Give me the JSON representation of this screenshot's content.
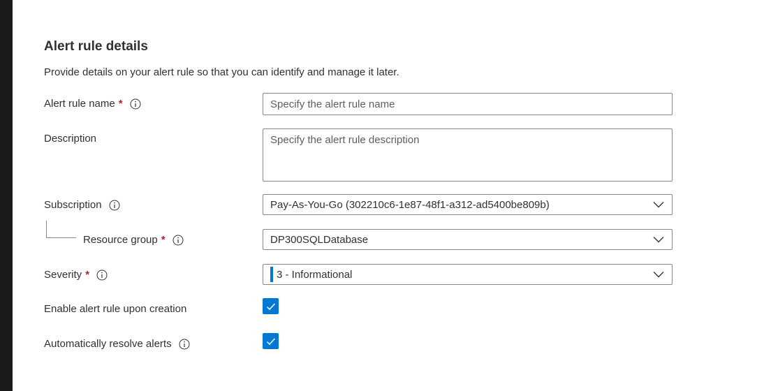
{
  "section": {
    "title": "Alert rule details",
    "description": "Provide details on your alert rule so that you can identify and manage it later."
  },
  "fields": {
    "alert_rule_name": {
      "label": "Alert rule name",
      "required_marker": "*",
      "value": "",
      "placeholder": "Specify the alert rule name"
    },
    "description": {
      "label": "Description",
      "value": "",
      "placeholder": "Specify the alert rule description"
    },
    "subscription": {
      "label": "Subscription",
      "value": "Pay-As-You-Go (302210c6-1e87-48f1-a312-ad5400be809b)"
    },
    "resource_group": {
      "label": "Resource group",
      "required_marker": "*",
      "value": "DP300SQLDatabase"
    },
    "severity": {
      "label": "Severity",
      "required_marker": "*",
      "value": "3 - Informational",
      "color": "#0078d4"
    },
    "enable_on_creation": {
      "label": "Enable alert rule upon creation",
      "checked": true
    },
    "auto_resolve": {
      "label": "Automatically resolve alerts",
      "checked": true
    }
  },
  "icons": {
    "info": "info-icon",
    "chevron": "chevron-down-icon",
    "check": "checkmark-icon"
  },
  "colors": {
    "accent": "#0078d4",
    "required": "#a4262c",
    "text": "#323130",
    "border": "#8a8886"
  }
}
